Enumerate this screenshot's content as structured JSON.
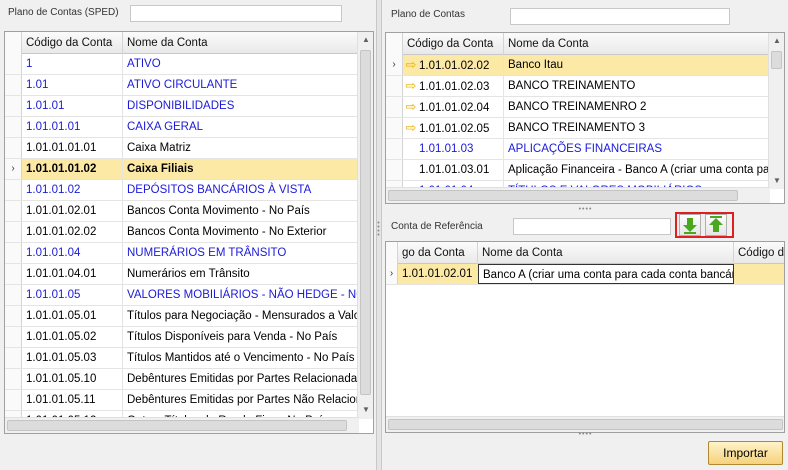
{
  "left_panel": {
    "title": "Plano de Contas (SPED)",
    "search_value": "",
    "columns": [
      "Código da Conta",
      "Nome da Conta"
    ],
    "rows": [
      {
        "code": "1",
        "name": "ATIVO",
        "style": "blue",
        "selected": false
      },
      {
        "code": "1.01",
        "name": "ATIVO CIRCULANTE",
        "style": "blue",
        "selected": false
      },
      {
        "code": "1.01.01",
        "name": "DISPONIBILIDADES",
        "style": "blue",
        "selected": false
      },
      {
        "code": "1.01.01.01",
        "name": "CAIXA GERAL",
        "style": "blue",
        "selected": false
      },
      {
        "code": "1.01.01.01.01",
        "name": "Caixa Matriz",
        "style": "normal",
        "selected": false
      },
      {
        "code": "1.01.01.01.02",
        "name": "Caixa Filiais",
        "style": "bold",
        "selected": true
      },
      {
        "code": "1.01.01.02",
        "name": "DEPÓSITOS BANCÁRIOS À VISTA",
        "style": "blue",
        "selected": false
      },
      {
        "code": "1.01.01.02.01",
        "name": "Bancos Conta Movimento - No País",
        "style": "normal",
        "selected": false
      },
      {
        "code": "1.01.01.02.02",
        "name": "Bancos Conta Movimento - No Exterior",
        "style": "normal",
        "selected": false
      },
      {
        "code": "1.01.01.04",
        "name": "NUMERÁRIOS EM TRÂNSITO",
        "style": "blue",
        "selected": false
      },
      {
        "code": "1.01.01.04.01",
        "name": "Numerários em Trânsito",
        "style": "normal",
        "selected": false
      },
      {
        "code": "1.01.01.05",
        "name": "VALORES MOBILIÁRIOS  - NÃO HEDGE - NO PAÍS",
        "style": "blue",
        "selected": false
      },
      {
        "code": "1.01.01.05.01",
        "name": "Títulos para Negociação - Mensurados a Valor Justo",
        "style": "normal",
        "selected": false
      },
      {
        "code": "1.01.01.05.02",
        "name": "Títulos Disponíveis para Venda - No País",
        "style": "normal",
        "selected": false
      },
      {
        "code": "1.01.01.05.03",
        "name": "Títulos Mantidos até o Vencimento - No País",
        "style": "normal",
        "selected": false
      },
      {
        "code": "1.01.01.05.10",
        "name": "Debêntures Emitidas por Partes Relacionadas - No País",
        "style": "normal",
        "selected": false
      },
      {
        "code": "1.01.01.05.11",
        "name": "Debêntures Emitidas por Partes Não Relacionadas - No País",
        "style": "normal",
        "selected": false
      },
      {
        "code": "1.01.01.05.12",
        "name": "Outros Títulos de Renda Fixa - No País",
        "style": "normal",
        "selected": false
      }
    ]
  },
  "right_top_panel": {
    "title": "Plano de Contas",
    "search_value": "",
    "columns": [
      "Código da Conta",
      "Nome da Conta"
    ],
    "rows": [
      {
        "code": "1.01.01.02.02",
        "name": "Banco Itau",
        "style": "normal",
        "selected": true,
        "arrow": true
      },
      {
        "code": "1.01.01.02.03",
        "name": "BANCO TREINAMENTO",
        "style": "normal",
        "selected": false,
        "arrow": true
      },
      {
        "code": "1.01.01.02.04",
        "name": "BANCO TREINAMENRO 2",
        "style": "normal",
        "selected": false,
        "arrow": true
      },
      {
        "code": "1.01.01.02.05",
        "name": "BANCO TREINAMENTO 3",
        "style": "normal",
        "selected": false,
        "arrow": true
      },
      {
        "code": "1.01.01.03",
        "name": "APLICAÇÕES FINANCEIRAS",
        "style": "blue",
        "selected": false,
        "arrow": false
      },
      {
        "code": "1.01.01.03.01",
        "name": "Aplicação Financeira - Banco A (criar uma conta para cada",
        "style": "normal",
        "selected": false,
        "arrow": false
      },
      {
        "code": "1.01.01.04",
        "name": "TÍTULOS E VALORES MOBILIÁRIOS",
        "style": "blue",
        "selected": false,
        "arrow": false
      }
    ]
  },
  "right_bottom_panel": {
    "title": "Conta de Referência",
    "search_value": "",
    "columns": [
      "go da Conta",
      "Nome da Conta",
      "Código da"
    ],
    "rows": [
      {
        "code": "1.01.01.02.01",
        "name": "Banco A (criar uma conta para cada conta bancária)",
        "extra": "",
        "selected": true
      }
    ],
    "buttons": {
      "move_down_icon": "arrow-down-icon",
      "move_up_icon": "arrow-up-icon"
    }
  },
  "footer": {
    "import_label": "Importar"
  },
  "colors": {
    "selected_row": "#fde9a6",
    "blue_text": "#1a1ad8",
    "highlight_border": "#e02020",
    "icon_green": "#4aa81e"
  }
}
